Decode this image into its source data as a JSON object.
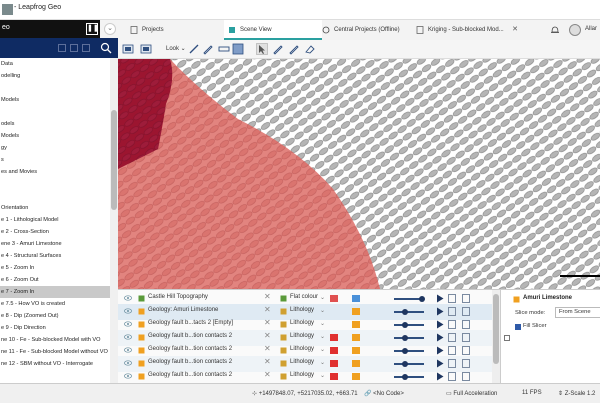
{
  "app": {
    "title": "- Leapfrog Geo"
  },
  "left_header": {
    "name": "eo"
  },
  "tabs": [
    {
      "label": "Projects"
    },
    {
      "label": "Scene View"
    },
    {
      "label": "Central Projects (Offline)"
    },
    {
      "label": "Kriging - Sub-blocked Mod..."
    }
  ],
  "user": {
    "name": "Allar"
  },
  "sidebar": {
    "items": [
      {
        "label": "Data"
      },
      {
        "label": "odelling"
      },
      {
        "label": ""
      },
      {
        "label": "Models"
      },
      {
        "label": ""
      },
      {
        "label": "odels"
      },
      {
        "label": "Models"
      },
      {
        "label": "gy"
      },
      {
        "label": "s"
      },
      {
        "label": "es and Movies"
      },
      {
        "label": ""
      },
      {
        "label": ""
      },
      {
        "label": "Orientation"
      },
      {
        "label": "e 1 - Lithological Model"
      },
      {
        "label": "e 2 - Cross-Section"
      },
      {
        "label": "ene 3 - Amuri Limestone"
      },
      {
        "label": "e 4 - Structural Surfaces"
      },
      {
        "label": "e 5 - Zoom In"
      },
      {
        "label": "e 6 - Zoom Out"
      },
      {
        "label": "e 7 - Zoom In"
      },
      {
        "label": "e 7.5 - How VO is created"
      },
      {
        "label": "e 8 - Dip (Zoomed Out)"
      },
      {
        "label": "e 9 - Dip Direction"
      },
      {
        "label": "ne 10 - Fe - Sub-blocked Model with VO"
      },
      {
        "label": "ne 11 - Fe - Sub-blocked Model without VO"
      },
      {
        "label": "ne 12 - SBM without VO - Interrogate"
      }
    ],
    "selected_index": 19
  },
  "scene_toolbar": {
    "look_label": "Look"
  },
  "shapes": [
    {
      "name": "Castle Hill Topography",
      "property": "Flat colour",
      "color1": "#e05050",
      "color2": "#4a90d9",
      "slider": 0.92
    },
    {
      "name": "Geology: Amuri Limestone",
      "property": "Lithology",
      "color1": "",
      "color2": "#f0a020",
      "slider": 0.38
    },
    {
      "name": "Geology fault b...tacts 2 [Empty]",
      "property": "Lithology",
      "color1": "",
      "color2": "#f0a020",
      "slider": 0.38
    },
    {
      "name": "Geology fault b...tion contacts 2",
      "property": "Lithology",
      "color1": "#e03030",
      "color2": "#f0a020",
      "slider": 0.38
    },
    {
      "name": "Geology fault b...tion contacts 2",
      "property": "Lithology",
      "color1": "#e03030",
      "color2": "#f0a020",
      "slider": 0.38
    },
    {
      "name": "Geology fault b...tion contacts 2",
      "property": "Lithology",
      "color1": "#e03030",
      "color2": "#f0a020",
      "slider": 0.38
    },
    {
      "name": "Geology fault b...tion contacts 2",
      "property": "Lithology",
      "color1": "#e03030",
      "color2": "#f0a020",
      "slider": 0.38
    }
  ],
  "props": {
    "title": "Amuri Limestone",
    "slice_label": "Slice mode:",
    "slice_value": "From Scene",
    "fill_label": "Fill Slicer",
    "fill_checked": true
  },
  "status": {
    "coords": "+1497848.07, +5217035.02, +663.71",
    "code": "<No Code>",
    "accel": "Full Acceleration",
    "fps": "11 FPS",
    "zscale": "Z-Scale 1.2"
  }
}
